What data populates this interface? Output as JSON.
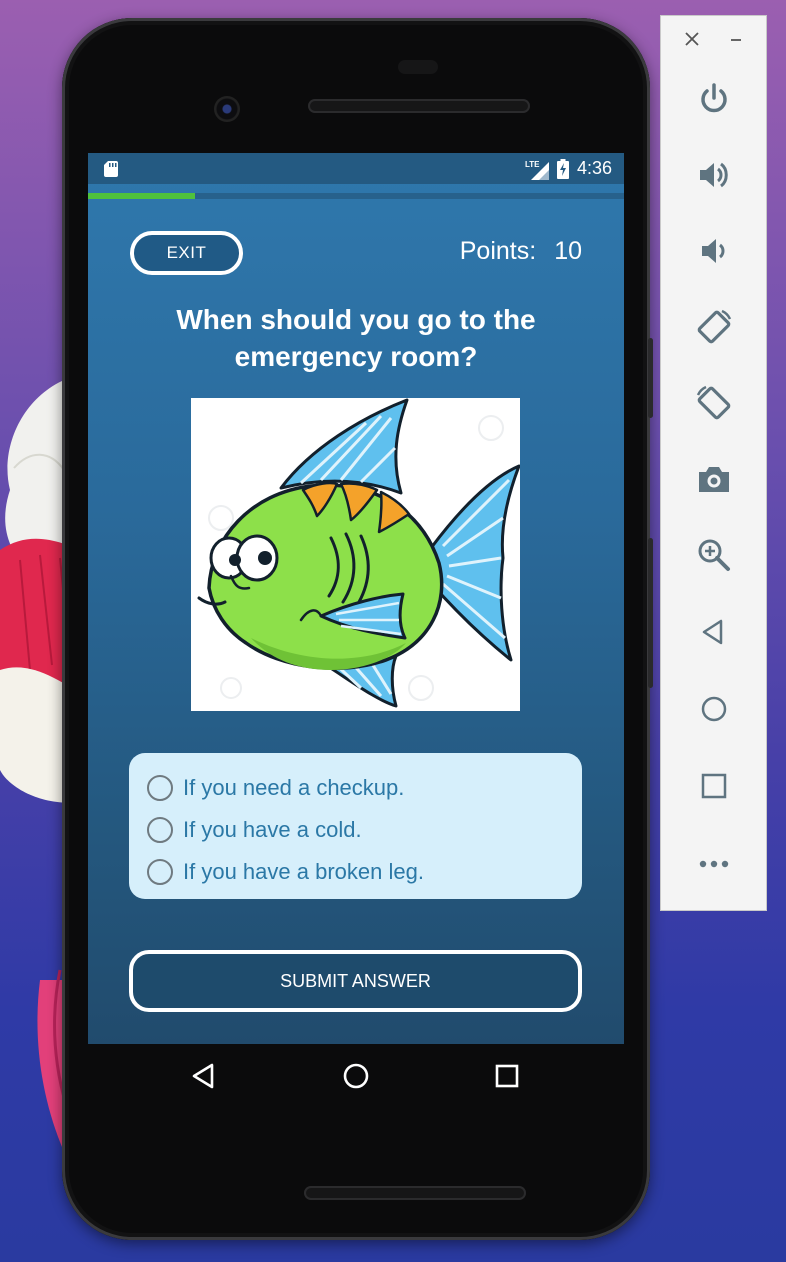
{
  "status_bar": {
    "network": "LTE",
    "time": "4:36"
  },
  "quiz": {
    "progress_fraction": 0.2,
    "exit_label": "EXIT",
    "points_label": "Points:",
    "points_value": "10",
    "question": "When should you go to the emergency room?",
    "picture": "cartoon-fish",
    "options": [
      {
        "label": "If you need a checkup.",
        "selected": false
      },
      {
        "label": "If you have a cold.",
        "selected": false
      },
      {
        "label": "If you have a broken leg.",
        "selected": false
      }
    ],
    "submit_label": "SUBMIT ANSWER"
  },
  "navigation": [
    "back-icon",
    "home-icon",
    "recents-icon"
  ],
  "emulator_toolbar": {
    "window_controls": [
      "close-icon",
      "minimize-icon"
    ],
    "items": [
      "power-icon",
      "volume-up-icon",
      "volume-down-icon",
      "rotate-left-icon",
      "rotate-right-icon",
      "camera-icon",
      "zoom-icon",
      "back-icon",
      "home-icon",
      "overview-icon",
      "more-icon"
    ]
  },
  "colors": {
    "screen_top": "#2f78ad",
    "screen_bottom": "#214b6d",
    "progress": "#4fc23c",
    "option_panel": "#d6effb",
    "option_text": "#2b78a6",
    "fish_body": "#8de04a",
    "fish_fins": "#5fc0ee"
  }
}
